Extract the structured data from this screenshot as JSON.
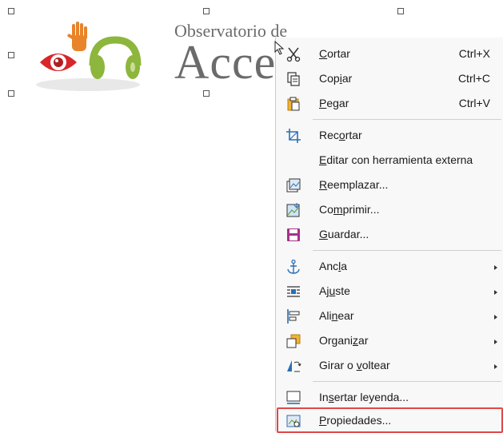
{
  "document": {
    "logo": {
      "line1": "Observatorio de",
      "line2": "Accesi"
    }
  },
  "context_menu": {
    "items": [
      {
        "pre": "",
        "ul": "C",
        "post": "ortar",
        "shortcut": "Ctrl+X",
        "icon": "cut-icon"
      },
      {
        "pre": "Cop",
        "ul": "i",
        "post": "ar",
        "shortcut": "Ctrl+C",
        "icon": "copy-icon"
      },
      {
        "pre": "",
        "ul": "P",
        "post": "egar",
        "shortcut": "Ctrl+V",
        "icon": "paste-icon"
      },
      {
        "pre": "Rec",
        "ul": "o",
        "post": "rtar",
        "shortcut": "",
        "icon": "crop-icon"
      },
      {
        "pre": "",
        "ul": "E",
        "post": "ditar con herramienta externa",
        "shortcut": "",
        "icon": ""
      },
      {
        "pre": "",
        "ul": "R",
        "post": "eemplazar...",
        "shortcut": "",
        "icon": "replace-image-icon"
      },
      {
        "pre": "Co",
        "ul": "m",
        "post": "primir...",
        "shortcut": "",
        "icon": "compress-icon"
      },
      {
        "pre": "",
        "ul": "G",
        "post": "uardar...",
        "shortcut": "",
        "icon": "save-icon"
      },
      {
        "pre": "Anc",
        "ul": "l",
        "post": "a",
        "shortcut": "",
        "icon": "anchor-icon",
        "submenu": true
      },
      {
        "pre": "Aj",
        "ul": "u",
        "post": "ste",
        "shortcut": "",
        "icon": "wrap-icon",
        "submenu": true
      },
      {
        "pre": "Ali",
        "ul": "n",
        "post": "ear",
        "shortcut": "",
        "icon": "align-icon",
        "submenu": true
      },
      {
        "pre": "Organi",
        "ul": "z",
        "post": "ar",
        "shortcut": "",
        "icon": "arrange-icon",
        "submenu": true
      },
      {
        "pre": "Girar o ",
        "ul": "v",
        "post": "oltear",
        "shortcut": "",
        "icon": "rotate-flip-icon",
        "submenu": true
      },
      {
        "pre": "In",
        "ul": "s",
        "post": "ertar leyenda...",
        "shortcut": "",
        "icon": "caption-icon"
      },
      {
        "pre": "",
        "ul": "P",
        "post": "ropiedades...",
        "shortcut": "",
        "icon": "properties-icon"
      }
    ]
  },
  "colors": {
    "menu_bg": "#f8f8f8",
    "highlight_border": "#e04848",
    "eye_red": "#d8262b",
    "hand_orange": "#e8842a",
    "headphones_green": "#8db63c"
  }
}
